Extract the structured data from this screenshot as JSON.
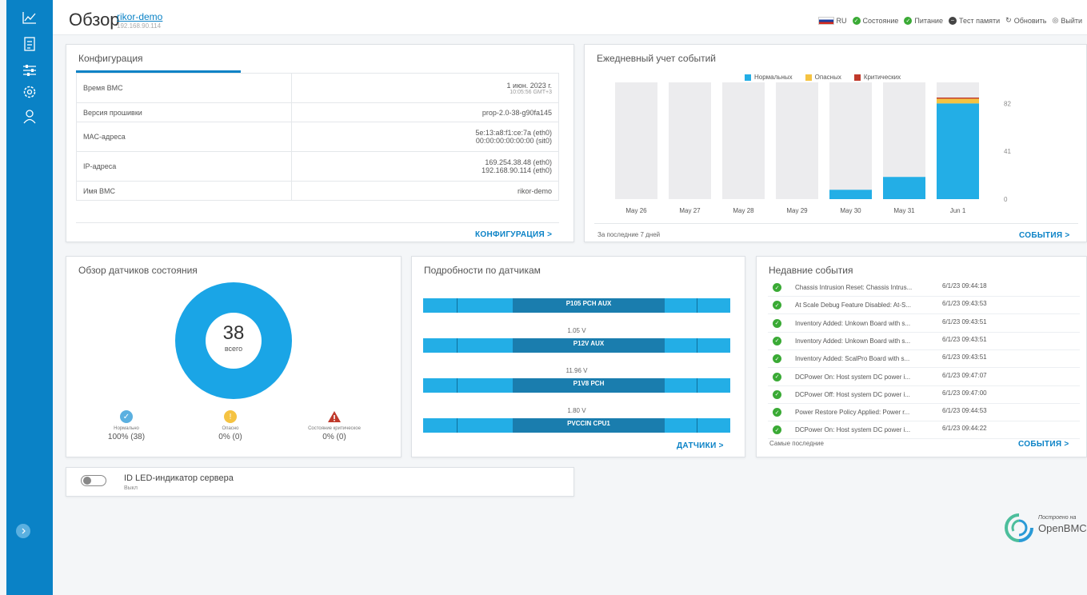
{
  "header": {
    "title": "Обзор",
    "host_name": "rikor-demo",
    "host_ip": "192.168.90.114",
    "lang": "RU",
    "status_label": "Состояние",
    "power_label": "Питание",
    "memtest_label": "Тест памяти",
    "refresh_label": "Обновить",
    "logout_label": "Выйти"
  },
  "sidebar": {
    "items": [
      "chart-icon",
      "list-icon",
      "sliders-icon",
      "gear-icon",
      "user-icon"
    ]
  },
  "config": {
    "title": "Конфигурация",
    "rows": [
      {
        "label": "Время BMC",
        "value": "1 июн. 2023 г.",
        "sub": "10:05:56 GMT+3"
      },
      {
        "label": "Версия прошивки",
        "value": "prop-2.0-38-g90fa145",
        "sub": ""
      },
      {
        "label": "MAC-адреса",
        "value": "5e:13:a8:f1:ce:7a (eth0)",
        "sub": "00:00:00:00:00:00 (sit0)"
      },
      {
        "label": "IP-адреса",
        "value": "169.254.38.48 (eth0)",
        "sub": "192.168.90.114 (eth0)"
      },
      {
        "label": "Имя BMC",
        "value": "rikor-demo",
        "sub": ""
      }
    ],
    "link": "КОНФИГУРАЦИЯ >"
  },
  "events_chart": {
    "title": "Ежедневный учет событий",
    "footer": "За последние 7 дней",
    "link": "СОБЫТИЯ >"
  },
  "chart_data": {
    "type": "bar",
    "categories": [
      "May 26",
      "May 27",
      "May 28",
      "May 29",
      "May 30",
      "May 31",
      "Jun 1"
    ],
    "series": [
      {
        "name": "Нормальных",
        "color": "#23aee6",
        "values": [
          0,
          0,
          0,
          0,
          8,
          19,
          82
        ]
      },
      {
        "name": "Опасных",
        "color": "#f5c342",
        "values": [
          0,
          0,
          0,
          0,
          0,
          0,
          4
        ]
      },
      {
        "name": "Критических",
        "color": "#c0392b",
        "values": [
          0,
          0,
          0,
          0,
          0,
          0,
          1
        ]
      }
    ],
    "yticks": [
      "0",
      "41",
      "82"
    ],
    "ylim": [
      0,
      100
    ],
    "stacked": true,
    "legend": "top"
  },
  "sensor_overview": {
    "title": "Обзор датчиков состояния",
    "total": "38",
    "total_label": "всего",
    "statuses": [
      {
        "name": "Нормально",
        "count": "100% (38)",
        "color": "#5bb0e0"
      },
      {
        "name": "Опасно",
        "count": "0% (0)",
        "color": "#f5c342"
      },
      {
        "name": "Состояние критическое",
        "count": "0% (0)",
        "color": "#c0392b"
      }
    ]
  },
  "sensor_details": {
    "title": "Подробности по датчикам",
    "sensors": [
      {
        "name": "P105 PCH AUX",
        "value": "1.05  V"
      },
      {
        "name": "P12V AUX",
        "value": "11.96  V"
      },
      {
        "name": "P1V8 PCH",
        "value": "1.80  V"
      },
      {
        "name": "PVCCIN CPU1",
        "value": ""
      }
    ],
    "link": "ДАТЧИКИ >"
  },
  "recent_events": {
    "title": "Недавние события",
    "items": [
      {
        "text": "Chassis Intrusion Reset: Chassis Intrus...",
        "time": "6/1/23 09:44:18"
      },
      {
        "text": "At Scale Debug Feature Disabled: At-S...",
        "time": "6/1/23 09:43:53"
      },
      {
        "text": "Inventory Added: Unkown Board with s...",
        "time": "6/1/23 09:43:51"
      },
      {
        "text": "Inventory Added: Unkown Board with s...",
        "time": "6/1/23 09:43:51"
      },
      {
        "text": "Inventory Added: ScalPro Board with s...",
        "time": "6/1/23 09:43:51"
      },
      {
        "text": "DCPower On: Host system DC power i...",
        "time": "6/1/23 09:47:07"
      },
      {
        "text": "DCPower Off: Host system DC power i...",
        "time": "6/1/23 09:47:00"
      },
      {
        "text": "Power Restore Policy Applied: Power r...",
        "time": "6/1/23 09:44:53"
      },
      {
        "text": "DCPower On: Host system DC power i...",
        "time": "6/1/23 09:44:22"
      }
    ],
    "footer": "Самые последние",
    "link": "СОБЫТИЯ >"
  },
  "led": {
    "title": "ID LED-индикатор сервера",
    "state": "Выкл"
  },
  "logo": {
    "tagline": "Построено на",
    "name": "OpenBMC"
  }
}
